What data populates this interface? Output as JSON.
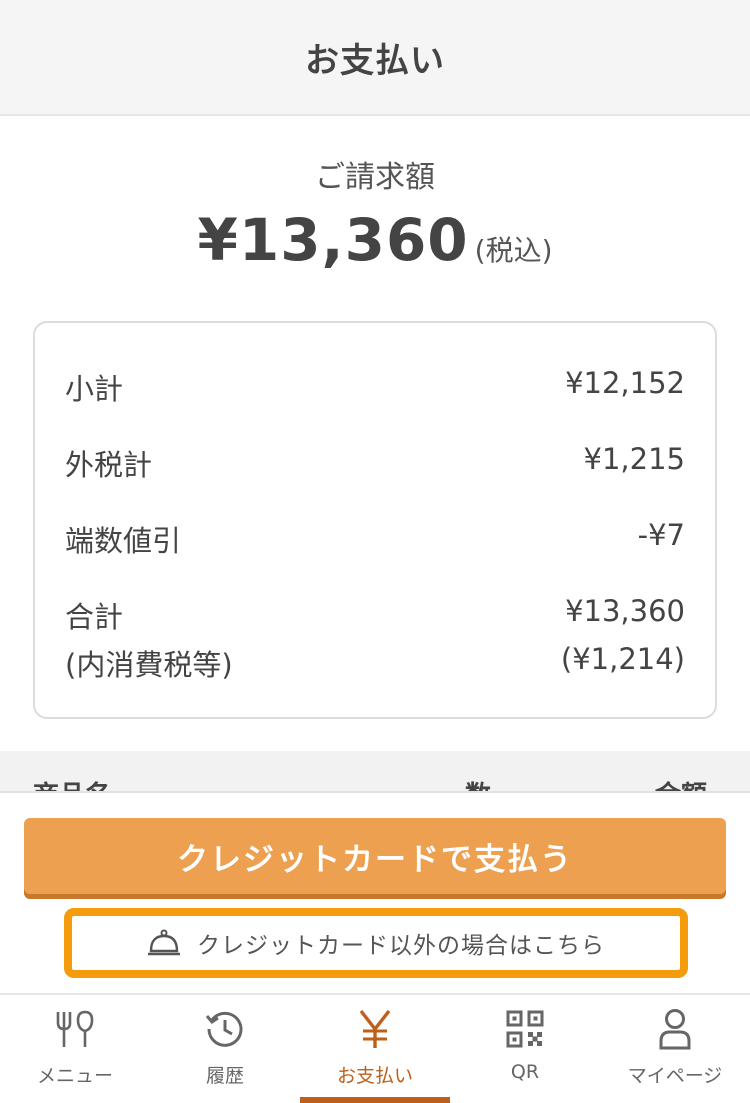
{
  "header": {
    "title": "お支払い"
  },
  "amount": {
    "label": "ご請求額",
    "value": "¥13,360",
    "suffix": "(税込)"
  },
  "breakdown": {
    "subtotal_label": "小計",
    "subtotal_value": "¥12,152",
    "tax_label": "外税計",
    "tax_value": "¥1,215",
    "rounding_label": "端数値引",
    "rounding_value": "-¥7",
    "total_label": "合計",
    "total_value": "¥13,360",
    "included_tax_label": "(内消費税等)",
    "included_tax_value": "(¥1,214)"
  },
  "table_header": {
    "name": "商品名",
    "qty": "数",
    "amount": "金額"
  },
  "actions": {
    "pay_credit_label": "クレジットカードで支払う",
    "pay_other_label": "クレジットカード以外の場合はこちら",
    "pay_other_icon": "bell-icon"
  },
  "nav": {
    "items": [
      {
        "label": "メニュー",
        "icon": "fork-knife-icon"
      },
      {
        "label": "履歴",
        "icon": "history-icon"
      },
      {
        "label": "お支払い",
        "icon": "yen-icon",
        "active": true
      },
      {
        "label": "QR",
        "icon": "qr-icon"
      },
      {
        "label": "マイページ",
        "icon": "user-icon"
      }
    ]
  },
  "colors": {
    "accent": "#eca050",
    "accent_border": "#f59c0c",
    "active_nav": "#c05f1a"
  }
}
